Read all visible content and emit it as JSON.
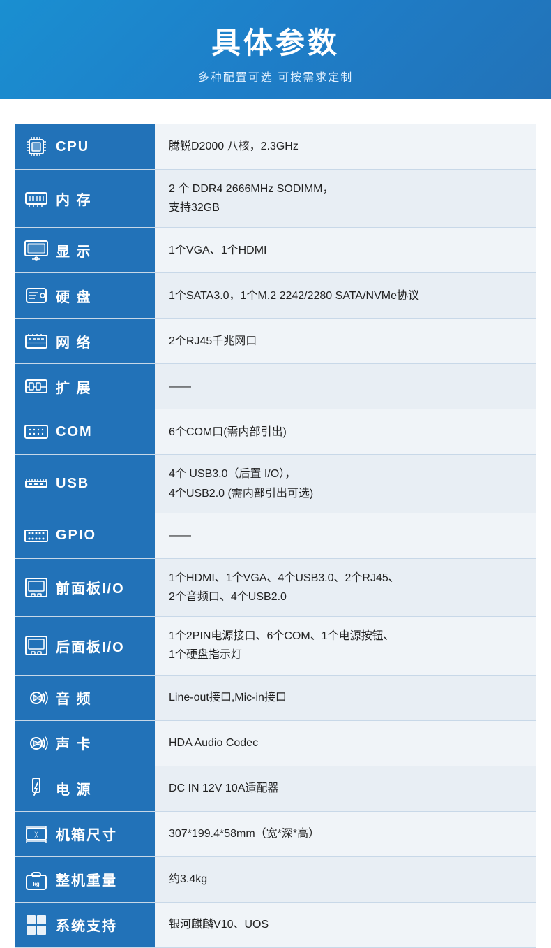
{
  "header": {
    "title": "具体参数",
    "subtitle": "多种配置可选 可按需求定制"
  },
  "rows": [
    {
      "id": "cpu",
      "label": "CPU",
      "value": "腾锐D2000 八核，2.3GHz",
      "icon": "cpu"
    },
    {
      "id": "memory",
      "label": "内 存",
      "value": "2 个 DDR4 2666MHz SODIMM，\n支持32GB",
      "icon": "memory"
    },
    {
      "id": "display",
      "label": "显 示",
      "value": "1个VGA、1个HDMI",
      "icon": "display"
    },
    {
      "id": "hdd",
      "label": "硬 盘",
      "value": "1个SATA3.0，1个M.2 2242/2280 SATA/NVMe协议",
      "icon": "hdd"
    },
    {
      "id": "network",
      "label": "网 络",
      "value": "2个RJ45千兆网口",
      "icon": "network"
    },
    {
      "id": "expansion",
      "label": "扩 展",
      "value": "——",
      "icon": "expansion"
    },
    {
      "id": "com",
      "label": "COM",
      "value": "6个COM口(需内部引出)",
      "icon": "com"
    },
    {
      "id": "usb",
      "label": "USB",
      "value": "4个 USB3.0（后置 I/O），\n4个USB2.0 (需内部引出可选)",
      "icon": "usb"
    },
    {
      "id": "gpio",
      "label": "GPIO",
      "value": "——",
      "icon": "gpio"
    },
    {
      "id": "frontio",
      "label": "前面板I/O",
      "value": "1个HDMI、1个VGA、4个USB3.0、2个RJ45、\n2个音频口、4个USB2.0",
      "icon": "frontio"
    },
    {
      "id": "reario",
      "label": "后面板I/O",
      "value": "1个2PIN电源接口、6个COM、1个电源按钮、\n1个硬盘指示灯",
      "icon": "reario"
    },
    {
      "id": "audio",
      "label": "音 频",
      "value": "Line-out接口,Mic-in接口",
      "icon": "audio"
    },
    {
      "id": "soundcard",
      "label": "声 卡",
      "value": "HDA Audio Codec",
      "icon": "soundcard"
    },
    {
      "id": "power",
      "label": "电 源",
      "value": "DC IN 12V 10A适配器",
      "icon": "power"
    },
    {
      "id": "size",
      "label": "机箱尺寸",
      "value": "307*199.4*58mm（宽*深*高）",
      "icon": "size"
    },
    {
      "id": "weight",
      "label": "整机重量",
      "value": "约3.4kg",
      "icon": "weight"
    },
    {
      "id": "os",
      "label": "系统支持",
      "value": "银河麒麟V10、UOS",
      "icon": "os"
    }
  ]
}
